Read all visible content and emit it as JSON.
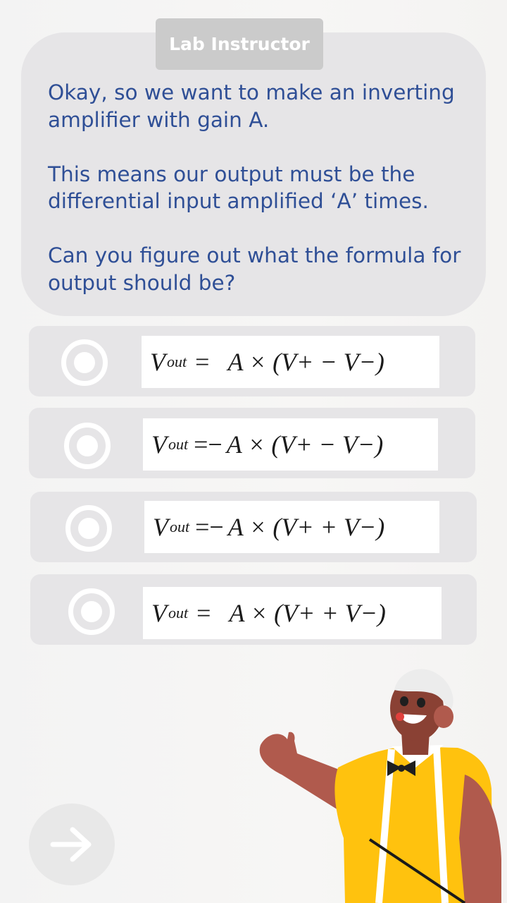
{
  "speaker": "Lab Instructor",
  "prompt": {
    "line1": "Okay, so we want to make an inverting amplifier with gain A.",
    "line2": "This means our output must be the differential input amplified ‘A’ times.",
    "line3": "Can you figure out what the formula for output should be?"
  },
  "options": [
    {
      "lhs": "V",
      "sub": "out",
      "eq": "=",
      "rhs": "A × (V+ − V−)"
    },
    {
      "lhs": "V",
      "sub": "out",
      "eq": "=−",
      "rhs": "A × (V+ − V−)"
    },
    {
      "lhs": "V",
      "sub": "out",
      "eq": "=−",
      "rhs": "A × (V+ + V−)"
    },
    {
      "lhs": "V",
      "sub": "out",
      "eq": "=",
      "rhs": "A × (V+ + V−)"
    }
  ],
  "icons": {
    "radio": "radio-button-icon",
    "next": "arrow-right-icon"
  },
  "colors": {
    "prompt_text": "#2f4f96",
    "card_bg": "#e6e5e7",
    "tag_bg": "#cbcbcb",
    "shirt": "#ffc20e"
  }
}
